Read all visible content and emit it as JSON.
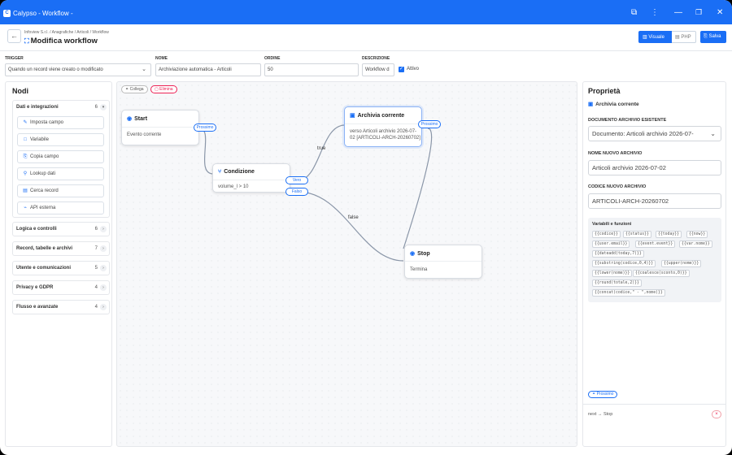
{
  "titlebar": {
    "title": "Calypso - Workflow -",
    "logo": "C",
    "icons": [
      "puzzle-icon",
      "kebab-menu-icon",
      "minimize-icon",
      "restore-icon",
      "close-icon"
    ]
  },
  "header": {
    "back": "←",
    "breadcrumb": "Infoview S.r.l. / Anagrafiche / Articoli / Workflow",
    "title": "Modifica workflow",
    "view_visual": "Visuale",
    "view_php": "PHP",
    "save": "Salva"
  },
  "form": {
    "trigger_label": "TRIGGER",
    "trigger_value": "Quando un record viene creato o modificato",
    "name_label": "NOME",
    "name_value": "Archiviazione automatica - Articoli",
    "order_label": "ORDINE",
    "order_value": "50",
    "desc_label": "DESCRIZIONE",
    "desc_value": "Workflow d",
    "active_label": "Attivo"
  },
  "nodes_panel": {
    "title": "Nodi",
    "categories": [
      {
        "name": "Dati e integrazioni",
        "count": "6"
      },
      {
        "name": "Logica e controlli",
        "count": "6"
      },
      {
        "name": "Record, tabelle e archivi",
        "count": "7"
      },
      {
        "name": "Utente e comunicazioni",
        "count": "5"
      },
      {
        "name": "Privacy e GDPR",
        "count": "4"
      },
      {
        "name": "Flusso e avanzate",
        "count": "4"
      }
    ],
    "items": [
      {
        "label": "Imposta campo",
        "icon": "✎"
      },
      {
        "label": "Variabile",
        "icon": "□"
      },
      {
        "label": "Copia campo",
        "icon": "⎘"
      },
      {
        "label": "Lookup dati",
        "icon": "⚲"
      },
      {
        "label": "Cerca record",
        "icon": "▤"
      },
      {
        "label": "API esterna",
        "icon": "⌁"
      }
    ]
  },
  "canvas": {
    "link_chip": "Collega",
    "delete_chip": "Elimina",
    "nodes": {
      "start": {
        "title": "Start",
        "body": "Evento corrente",
        "port": "Prossimo"
      },
      "condition": {
        "title": "Condizione",
        "body": "volume_l > 10",
        "port_true": "Vero",
        "port_false": "Falso"
      },
      "archive": {
        "title": "Archivia corrente",
        "body_line1": "verso Articoli archivio 2026-07-",
        "body_line2": "02 [ARTICOLI-ARCH-20260702]",
        "port": "Prossimo"
      },
      "stop": {
        "title": "Stop",
        "body": "Termina"
      }
    },
    "edge_true": "true",
    "edge_false": "false"
  },
  "props": {
    "title": "Proprietà",
    "subtitle": "Archivia corrente",
    "doc_label": "DOCUMENTO ARCHIVIO ESISTENTE",
    "doc_value": "Documento: Articoli archivio 2026-07-",
    "name_label": "NOME NUOVO ARCHIVIO",
    "name_value": "Articoli archivio 2026-07-02",
    "code_label": "CODICE NUOVO ARCHIVIO",
    "code_value": "ARTICOLI-ARCH-20260702",
    "vars_title": "Variabili e funzioni",
    "vars": [
      "{{codice}}",
      "{{status}}",
      "{{today}}",
      "{{now}}",
      "{{user.email}}",
      "{{event.event}}",
      "{{var.nome}}",
      "{{dateadd(today,7)}}",
      "{{substring(codice,0,4)}}",
      "{{upper(nome)}}",
      "{{lower(nome)}}",
      "{{coalesce(sconto,0)}}",
      "{{round(totale,2)}}",
      "{{concat(codice,\" - \",nome)}}"
    ],
    "next_chip": "Prossimo",
    "next_row": "next → Stop",
    "remove": "×"
  },
  "colors": {
    "accent": "#1a6ef5",
    "danger": "#e22255",
    "canvas_bg": "#f7f8fa"
  }
}
